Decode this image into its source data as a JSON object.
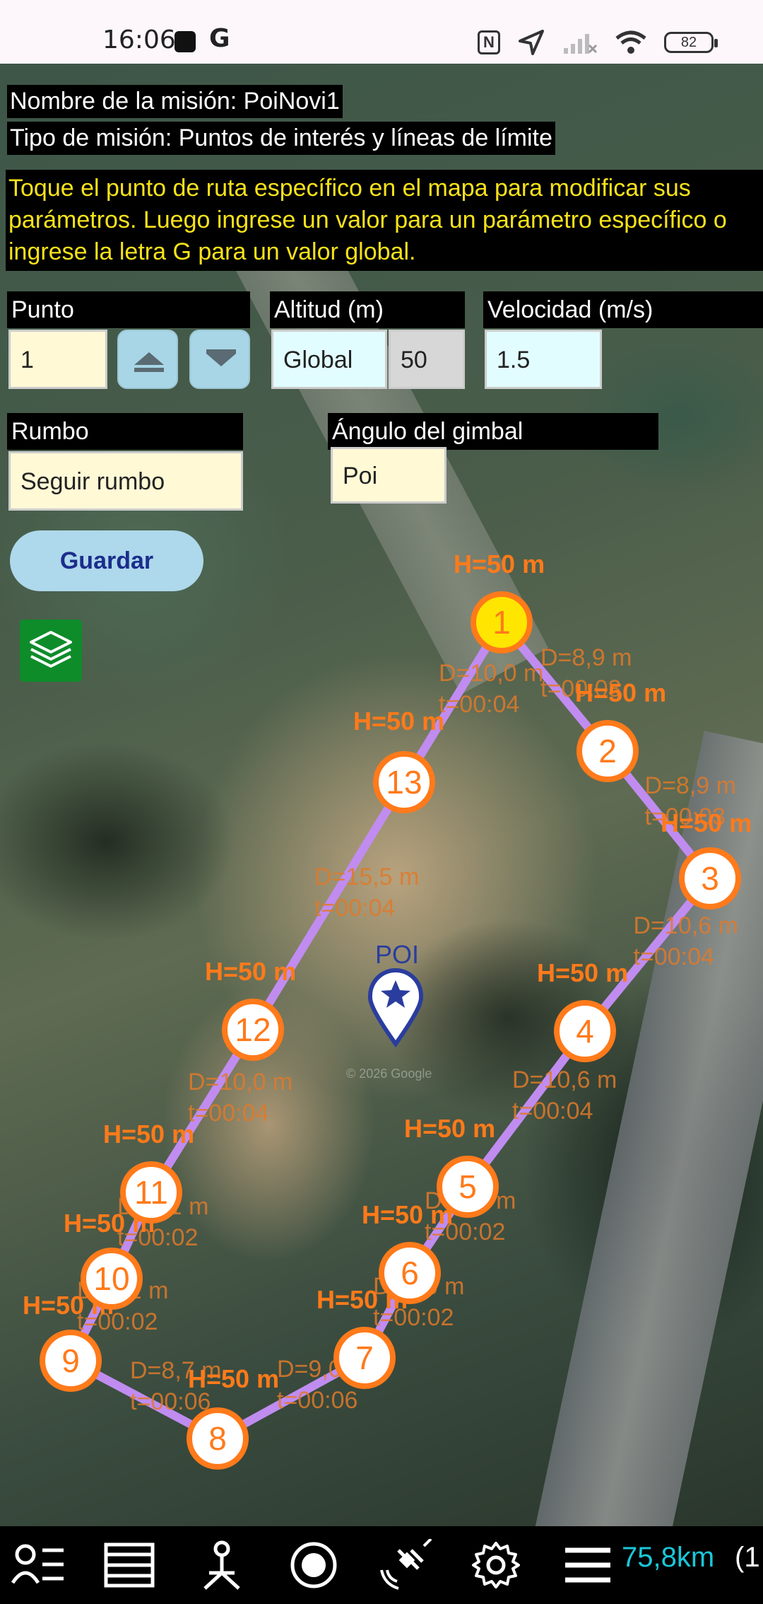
{
  "status_bar": {
    "time": "16:06",
    "battery": "82",
    "icons": [
      "square-notification-icon",
      "google-icon",
      "nfc-icon",
      "location-arrow-icon",
      "signal-icon",
      "wifi-icon",
      "battery-icon"
    ]
  },
  "mission": {
    "name_line": "Nombre de la misión: PoiNovi1",
    "type_line": "Tipo de misión: Puntos de interés y líneas de límite",
    "instructions": "Toque el punto de ruta específico en el mapa para modificar sus parámetros. Luego ingrese un valor para un parámetro específico o ingrese la letra G para un valor global."
  },
  "form": {
    "point_label": "Punto",
    "point_value": "1",
    "altitude_label": "Altitud  (m)",
    "altitude_mode": "Global",
    "altitude_value": "50",
    "speed_label": "Velocidad (m/s)",
    "speed_value": "1.5",
    "heading_label": "Rumbo",
    "heading_value": "Seguir rumbo",
    "gimbal_label": "Ángulo del gimbal",
    "gimbal_value": "Poi",
    "save_label": "Guardar"
  },
  "colors": {
    "instruction_text": "#f7e21b",
    "waypoint_stroke": "#ff7a1a",
    "selected_waypoint_fill": "#ffe600",
    "path": "#c08cf0",
    "poi": "#2a3d9e",
    "distance_text": "#19c7d9"
  },
  "map": {
    "poi_label": "POI",
    "watermark": "© 2026 Google",
    "waypoints": [
      {
        "num": "1",
        "height": "H=50 m",
        "selected": true
      },
      {
        "num": "2",
        "height": "H=50 m"
      },
      {
        "num": "3",
        "height": "H=50 m"
      },
      {
        "num": "4",
        "height": "H=50 m"
      },
      {
        "num": "5",
        "height": "H=50 m"
      },
      {
        "num": "6",
        "height": "H=50 m"
      },
      {
        "num": "7",
        "height": "H=50 m"
      },
      {
        "num": "8",
        "height": "H=50 m"
      },
      {
        "num": "9",
        "height": "H=50 m"
      },
      {
        "num": "10",
        "height": "H=50 m"
      },
      {
        "num": "11",
        "height": "H=50 m"
      },
      {
        "num": "12",
        "height": "H=50 m"
      },
      {
        "num": "13",
        "height": "H=50 m"
      }
    ],
    "segments": [
      {
        "d": "D=8,9 m",
        "t": "t=00:03"
      },
      {
        "d": "D=8,9 m",
        "t": "t=00:03"
      },
      {
        "d": "D=10,6 m",
        "t": "t=00:04"
      },
      {
        "d": "D=10,6 m",
        "t": "t=00:04"
      },
      {
        "d": "D=5,2 m",
        "t": "t=00:02"
      },
      {
        "d": "D=5,6 m",
        "t": "t=00:02"
      },
      {
        "d": "D=9,0 m",
        "t": "t=00:06"
      },
      {
        "d": "D=8,7 m",
        "t": "t=00:06"
      },
      {
        "d": "D=5,1 m",
        "t": "t=00:02"
      },
      {
        "d": "D=5,1 m",
        "t": "t=00:02"
      },
      {
        "d": "D=10,0 m",
        "t": "t=00:04"
      },
      {
        "d": "D=15,5 m",
        "t": "t=00:04"
      },
      {
        "d": "D=10,0 m",
        "t": "t=00:04"
      }
    ]
  },
  "bottom_bar": {
    "icons": [
      "profile-list-icon",
      "list-icon",
      "survey-icon",
      "record-icon",
      "satellite-icon",
      "settings-icon",
      "menu-icon"
    ],
    "distance": "75,8km",
    "extra": "(1"
  }
}
